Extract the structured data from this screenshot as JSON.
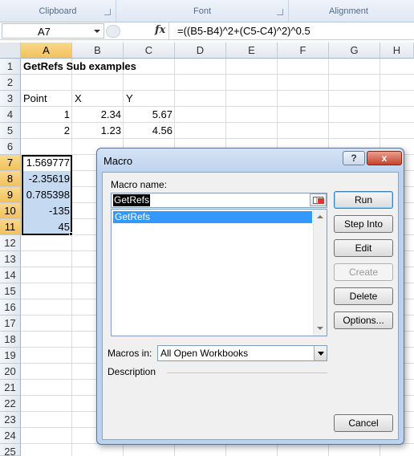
{
  "ribbon": {
    "groups": [
      {
        "label": "Clipboard"
      },
      {
        "label": "Font"
      },
      {
        "label": "Alignment"
      }
    ]
  },
  "formula_bar": {
    "name_box": "A7",
    "fx_label": "fx",
    "formula": "=((B5-B4)^2+(C5-C4)^2)^0.5"
  },
  "sheet": {
    "columns": [
      "A",
      "B",
      "C",
      "D",
      "E",
      "F",
      "G",
      "H"
    ],
    "selected_column": "A",
    "rows": [
      "1",
      "2",
      "3",
      "4",
      "5",
      "6",
      "7",
      "8",
      "9",
      "10",
      "11",
      "12",
      "13",
      "14",
      "15",
      "16",
      "17",
      "18",
      "19",
      "20",
      "21",
      "22",
      "23",
      "24",
      "25"
    ],
    "selected_rows": [
      "7",
      "8",
      "9",
      "10",
      "11"
    ],
    "cells": {
      "a1": "GetRefs Sub examples",
      "a3": "Point",
      "b3": "X",
      "c3": "Y",
      "a4": "1",
      "b4": "2.34",
      "c4": "5.67",
      "a5": "2",
      "b5": "1.23",
      "c5": "4.56",
      "a7": "1.569777",
      "a8": "-2.35619",
      "a9": "0.785398",
      "a10": "-135",
      "a11": "45"
    }
  },
  "macro_dialog": {
    "title": "Macro",
    "help_button": "?",
    "close_button": "x",
    "macro_name_label": "Macro name:",
    "macro_name_value": "GetRefs",
    "macro_list": [
      "GetRefs"
    ],
    "macros_in_label": "Macros in:",
    "macros_in_value": "All Open Workbooks",
    "description_label": "Description",
    "buttons": {
      "run": "Run",
      "step_into": "Step Into",
      "edit": "Edit",
      "create": "Create",
      "delete": "Delete",
      "options": "Options...",
      "cancel": "Cancel"
    }
  }
}
